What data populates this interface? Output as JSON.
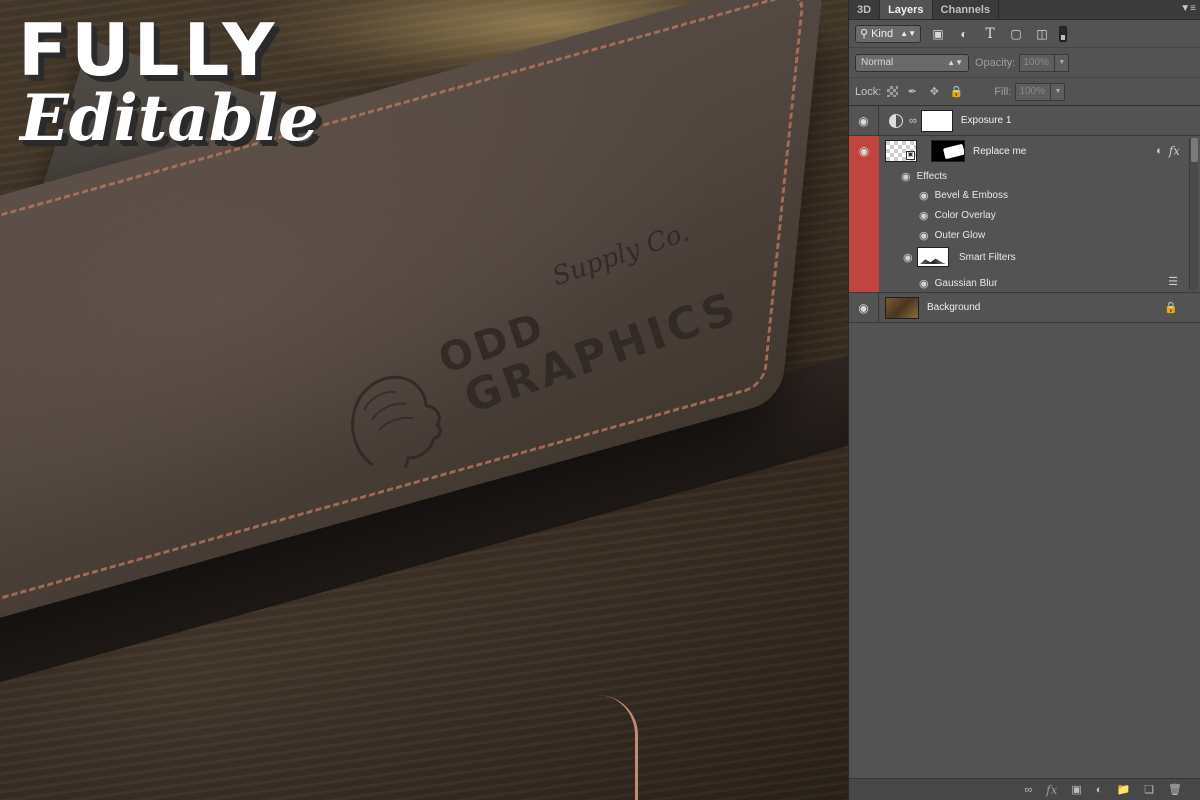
{
  "canvas": {
    "headline_line1": "FULLY",
    "headline_line2": "Editable",
    "stamp_line1": "ODD",
    "stamp_line2": "Supply Co.",
    "stamp_line3": "GRAPHICS"
  },
  "panel": {
    "tabs": [
      {
        "label": "3D",
        "active": false
      },
      {
        "label": "Layers",
        "active": true
      },
      {
        "label": "Channels",
        "active": false
      }
    ],
    "filter": {
      "kind_label": "Kind",
      "icons": [
        "image-filter-icon",
        "adjustment-filter-icon",
        "type-filter-icon",
        "shape-filter-icon",
        "smart-object-filter-icon"
      ],
      "type_glyph": "T"
    },
    "blend": {
      "mode": "Normal",
      "opacity_label": "Opacity:",
      "opacity_value": "100%"
    },
    "lock": {
      "label": "Lock:",
      "fill_label": "Fill:",
      "fill_value": "100%"
    },
    "layers": [
      {
        "name": "Exposure 1",
        "type": "adjustment",
        "visible": true
      },
      {
        "name": "Replace me",
        "type": "smart-object",
        "visible": true,
        "selected": true,
        "effects_label": "Effects",
        "effects": [
          "Bevel & Emboss",
          "Color Overlay",
          "Outer Glow"
        ],
        "smart_filters_label": "Smart Filters",
        "smart_filters": [
          "Gaussian Blur"
        ],
        "fx_glyph": "fx"
      },
      {
        "name": "Background",
        "type": "background",
        "visible": true,
        "locked": true
      }
    ],
    "footer_fx": "fx"
  },
  "colors": {
    "selected_layer": "#c0453f",
    "panel_bg": "#535353",
    "tab_bar": "#3b3b3b"
  }
}
